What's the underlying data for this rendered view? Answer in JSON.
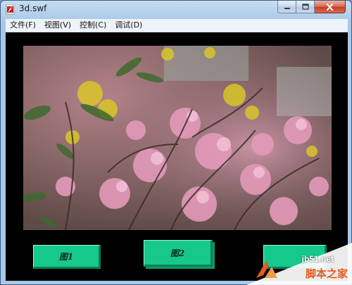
{
  "window": {
    "title": "3d.swf",
    "icon": "flash-document-icon"
  },
  "caption_buttons": {
    "minimize": "minimize-icon",
    "maximize": "maximize-icon",
    "close": "close-icon"
  },
  "menubar": {
    "items": [
      {
        "label": "文件(F)"
      },
      {
        "label": "视图(V)"
      },
      {
        "label": "控制(C)"
      },
      {
        "label": "调试(D)"
      }
    ]
  },
  "stage": {
    "photo": "flowering-tree-photo",
    "buttons": [
      {
        "label": "图1"
      },
      {
        "label": "图2"
      },
      {
        "label": ""
      }
    ]
  },
  "watermark": {
    "site": "jb51.net",
    "brand": "脚本之家"
  },
  "colors": {
    "stage_bg": "#000000",
    "button_face": "#16c98a",
    "button_shade": "#0a7f56",
    "watermark_orange": "#e25b20"
  }
}
